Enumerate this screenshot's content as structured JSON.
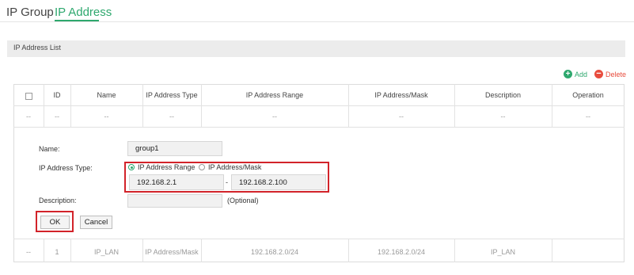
{
  "tabs": [
    {
      "label": "IP Group",
      "active": false
    },
    {
      "label": "IP Address",
      "active": true
    }
  ],
  "section": {
    "title": "IP Address List"
  },
  "toolbar": {
    "add_label": "Add",
    "delete_label": "Delete",
    "add_icon": "plus-circle-icon",
    "delete_icon": "minus-circle-icon"
  },
  "table": {
    "headers": [
      "ID",
      "Name",
      "IP Address Type",
      "IP Address Range",
      "IP Address/Mask",
      "Description",
      "Operation"
    ],
    "placeholder_row": [
      "--",
      "--",
      "--",
      "--",
      "--",
      "--",
      "--",
      "--"
    ],
    "rows": [
      {
        "dash": "--",
        "id": "1",
        "name": "IP_LAN",
        "type": "IP Address/Mask",
        "range": "192.168.2.0/24",
        "mask": "192.168.2.0/24",
        "description": "IP_LAN",
        "operation": ""
      }
    ]
  },
  "form": {
    "name_label": "Name:",
    "name_value": "group1",
    "type_label": "IP Address Type:",
    "type_options": [
      "IP Address Range",
      "IP Address/Mask"
    ],
    "type_selected": "IP Address Range",
    "range_start": "192.168.2.1",
    "range_separator": "-",
    "range_end": "192.168.2.100",
    "description_label": "Description:",
    "description_value": "",
    "description_hint": "(Optional)",
    "ok_label": "OK",
    "cancel_label": "Cancel"
  },
  "colors": {
    "accent": "#2ea86e",
    "danger": "#e84c3d",
    "highlight": "#d2232a"
  }
}
